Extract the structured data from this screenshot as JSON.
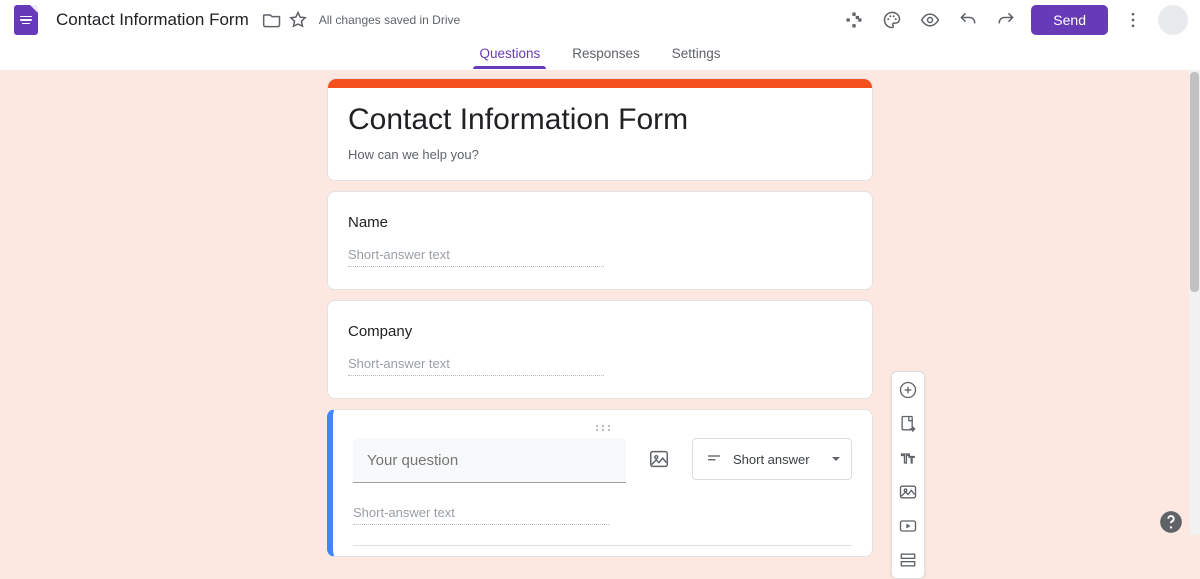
{
  "header": {
    "doc_title": "Contact Information Form",
    "save_status": "All changes saved in Drive",
    "send_label": "Send"
  },
  "tabs": {
    "questions": "Questions",
    "responses": "Responses",
    "settings": "Settings",
    "active": "questions"
  },
  "form": {
    "accent_color": "#f4511e",
    "title": "Contact Information Form",
    "description": "How can we help you?",
    "questions": [
      {
        "label": "Name",
        "answer_placeholder": "Short-answer text",
        "type": "Short answer"
      },
      {
        "label": "Company",
        "answer_placeholder": "Short-answer text",
        "type": "Short answer"
      }
    ],
    "active_question": {
      "input_placeholder": "Your question",
      "answer_placeholder": "Short-answer text",
      "type_label": "Short answer"
    }
  },
  "floating_toolbar": {
    "items": [
      "add-question",
      "import-questions",
      "add-title",
      "add-image",
      "add-video",
      "add-section"
    ]
  }
}
